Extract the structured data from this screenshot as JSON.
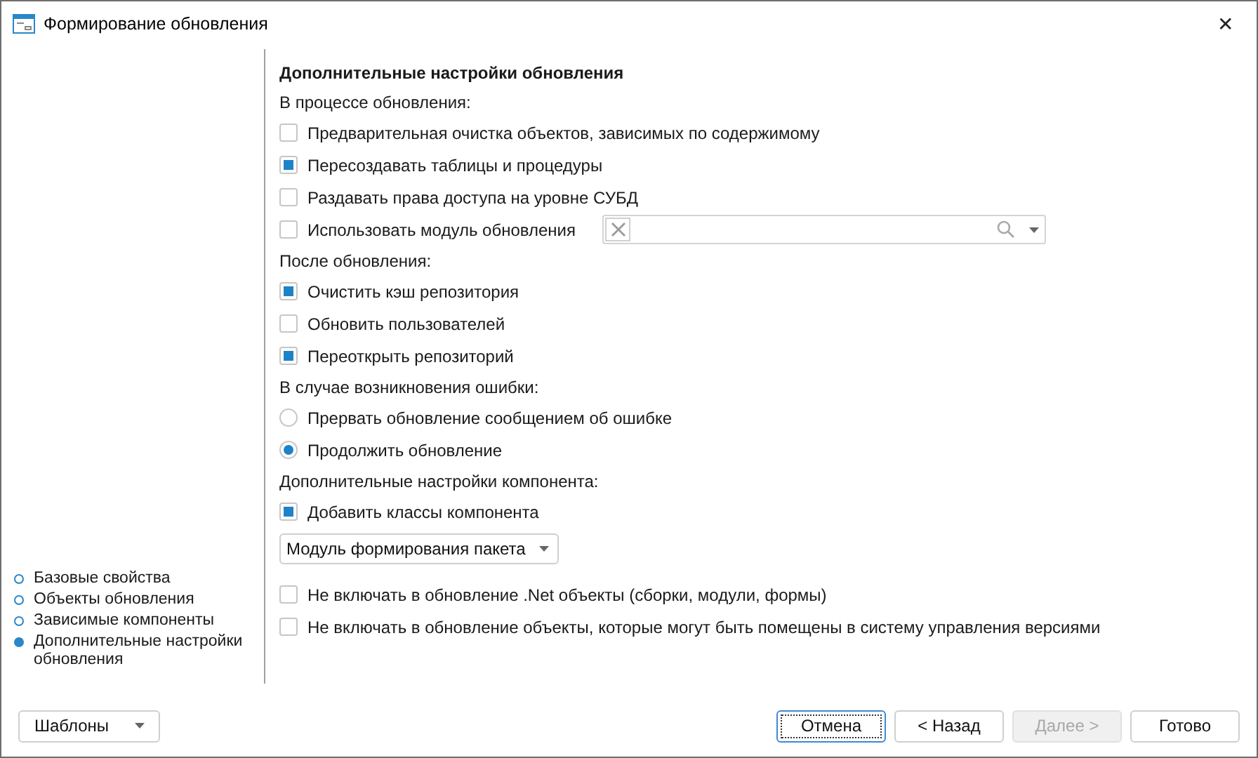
{
  "window": {
    "title": "Формирование обновления",
    "close": "✕"
  },
  "sidebar": {
    "items": [
      {
        "label": "Базовые свойства",
        "selected": false
      },
      {
        "label": "Объекты обновления",
        "selected": false
      },
      {
        "label": "Зависимые компоненты",
        "selected": false
      },
      {
        "label": "Дополнительные настройки обновления",
        "selected": true
      }
    ]
  },
  "content": {
    "heading": "Дополнительные настройки обновления",
    "items": [
      {
        "kind": "label",
        "text": "В процессе обновления:"
      },
      {
        "kind": "checkbox",
        "text": "Предварительная очистка объектов, зависимых по содержимому",
        "checked": false
      },
      {
        "kind": "checkbox",
        "text": "Пересоздавать таблицы и процедуры",
        "checked": true
      },
      {
        "kind": "checkbox",
        "text": "Раздавать права доступа на уровне СУБД",
        "checked": false
      },
      {
        "kind": "combo",
        "text": "Использовать модуль обновления",
        "checked": false
      },
      {
        "kind": "label",
        "text": "После обновления:"
      },
      {
        "kind": "checkbox",
        "text": "Очистить кэш репозитория",
        "checked": true
      },
      {
        "kind": "checkbox",
        "text": "Обновить пользователей",
        "checked": false
      },
      {
        "kind": "checkbox",
        "text": "Переоткрыть репозиторий",
        "checked": true
      },
      {
        "kind": "label",
        "text": "В случае возникновения ошибки:"
      },
      {
        "kind": "radio",
        "text": "Прервать обновление сообщением об ошибке",
        "selected": false
      },
      {
        "kind": "radio",
        "text": "Продолжить обновление",
        "selected": true
      },
      {
        "kind": "label",
        "text": "Дополнительные настройки компонента:"
      },
      {
        "kind": "checkbox",
        "text": "Добавить классы компонента",
        "checked": true
      },
      {
        "kind": "dropdown",
        "text": "Модуль формирования пакета"
      },
      {
        "kind": "checkbox",
        "text": "Не включать в обновление .Net объекты (сборки, модули, формы)",
        "checked": false
      },
      {
        "kind": "checkbox",
        "text": "Не включать в обновление объекты, которые могут быть помещены в систему управления версиями",
        "checked": false
      }
    ]
  },
  "footer": {
    "templates": "Шаблоны",
    "buttons": [
      {
        "label": "Отмена",
        "focused": true,
        "disabled": false
      },
      {
        "label": "< Назад",
        "focused": false,
        "disabled": false
      },
      {
        "label": "Далее >",
        "focused": false,
        "disabled": true
      },
      {
        "label": "Готово",
        "focused": false,
        "disabled": false
      }
    ]
  }
}
